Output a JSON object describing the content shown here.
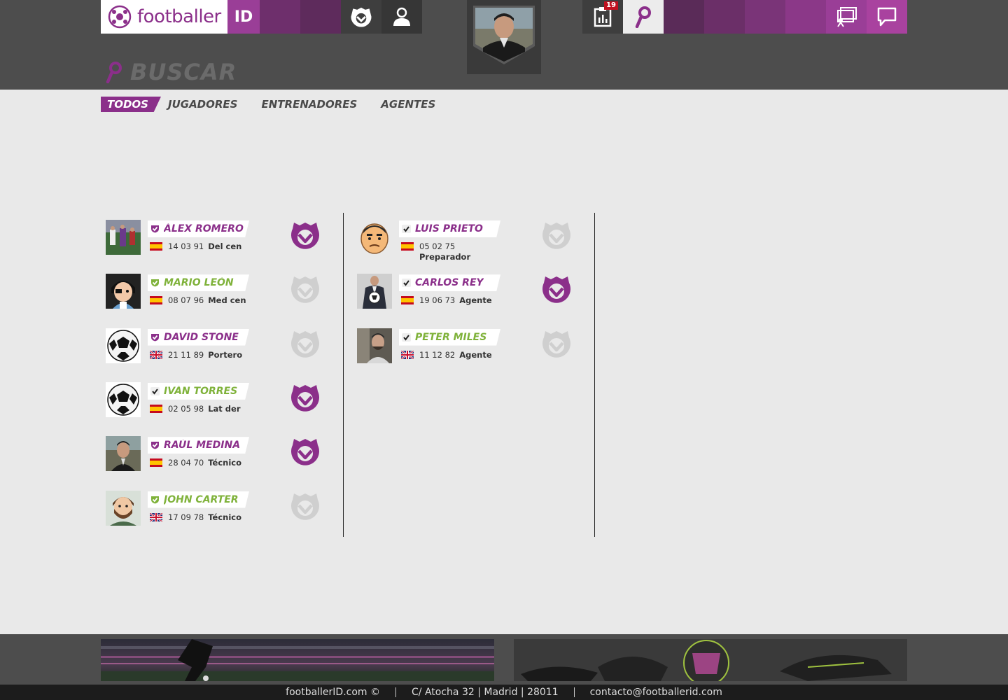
{
  "brand": {
    "name": "footballer",
    "suffix": "ID"
  },
  "notifications": {
    "count": "19"
  },
  "page": {
    "title": "BUSCAR"
  },
  "tabs": [
    {
      "label": "TODOS",
      "active": true
    },
    {
      "label": "JUGADORES"
    },
    {
      "label": "ENTRENADORES"
    },
    {
      "label": "AGENTES"
    }
  ],
  "results_left": [
    {
      "name": "ÁLEX ROMERO",
      "date": "14 03 91",
      "role": "Del cen",
      "flag": "es",
      "name_color": "purple",
      "badge": "purple-shield",
      "club_active": true,
      "avatar": "photo-field"
    },
    {
      "name": "MARIO LEÓN",
      "date": "08 07 96",
      "role": "Med cen",
      "flag": "es",
      "name_color": "green",
      "badge": "green-shield",
      "club_active": false,
      "avatar": "cartoon-pirate"
    },
    {
      "name": "DAVID STONE",
      "date": "21 11 89",
      "role": "Portero",
      "flag": "gb",
      "name_color": "purple",
      "badge": "purple-shield",
      "club_active": false,
      "avatar": "ball"
    },
    {
      "name": "IVÁN TORRES",
      "date": "02 05 98",
      "role": "Lat der",
      "flag": "es",
      "name_color": "green",
      "badge": "check",
      "club_active": true,
      "avatar": "ball"
    },
    {
      "name": "RAÚL MEDINA",
      "date": "28 04 70",
      "role": "Técnico",
      "flag": "es",
      "name_color": "purple",
      "badge": "purple-shield",
      "club_active": true,
      "avatar": "photo-man"
    },
    {
      "name": "JOHN CARTER",
      "date": "17 09 78",
      "role": "Técnico",
      "flag": "gb",
      "name_color": "green",
      "badge": "green-shield",
      "club_active": false,
      "avatar": "cartoon-beard"
    }
  ],
  "results_right": [
    {
      "name": "LUIS PRIETO",
      "date": "05 02 75",
      "role": "Preparador",
      "flag": "es",
      "name_color": "purple",
      "badge": "check",
      "club_active": false,
      "avatar": "emoji-face",
      "role_wrap": true
    },
    {
      "name": "CARLOS REY",
      "date": "19 06 73",
      "role": "Agente",
      "flag": "es",
      "name_color": "purple",
      "badge": "check",
      "club_active": true,
      "avatar": "photo-suit"
    },
    {
      "name": "PETER MILES",
      "date": "11 12 82",
      "role": "Agente",
      "flag": "gb",
      "name_color": "green",
      "badge": "check",
      "club_active": false,
      "avatar": "photo-selfie"
    }
  ],
  "footer": {
    "site": "footballerID.com ©",
    "address": "C/ Atocha 32 | Madrid | 28011",
    "email": "contacto@footballerid.com"
  },
  "icons": {
    "club": "club-crest-icon",
    "profile": "user-icon",
    "notifications": "clipboard-icon",
    "search": "search-icon",
    "chat": "chat-icon",
    "training": "training-board-icon"
  },
  "colors": {
    "purple": "#8b2f8a",
    "green": "#7fb23a",
    "header": "#4d4d4d"
  }
}
